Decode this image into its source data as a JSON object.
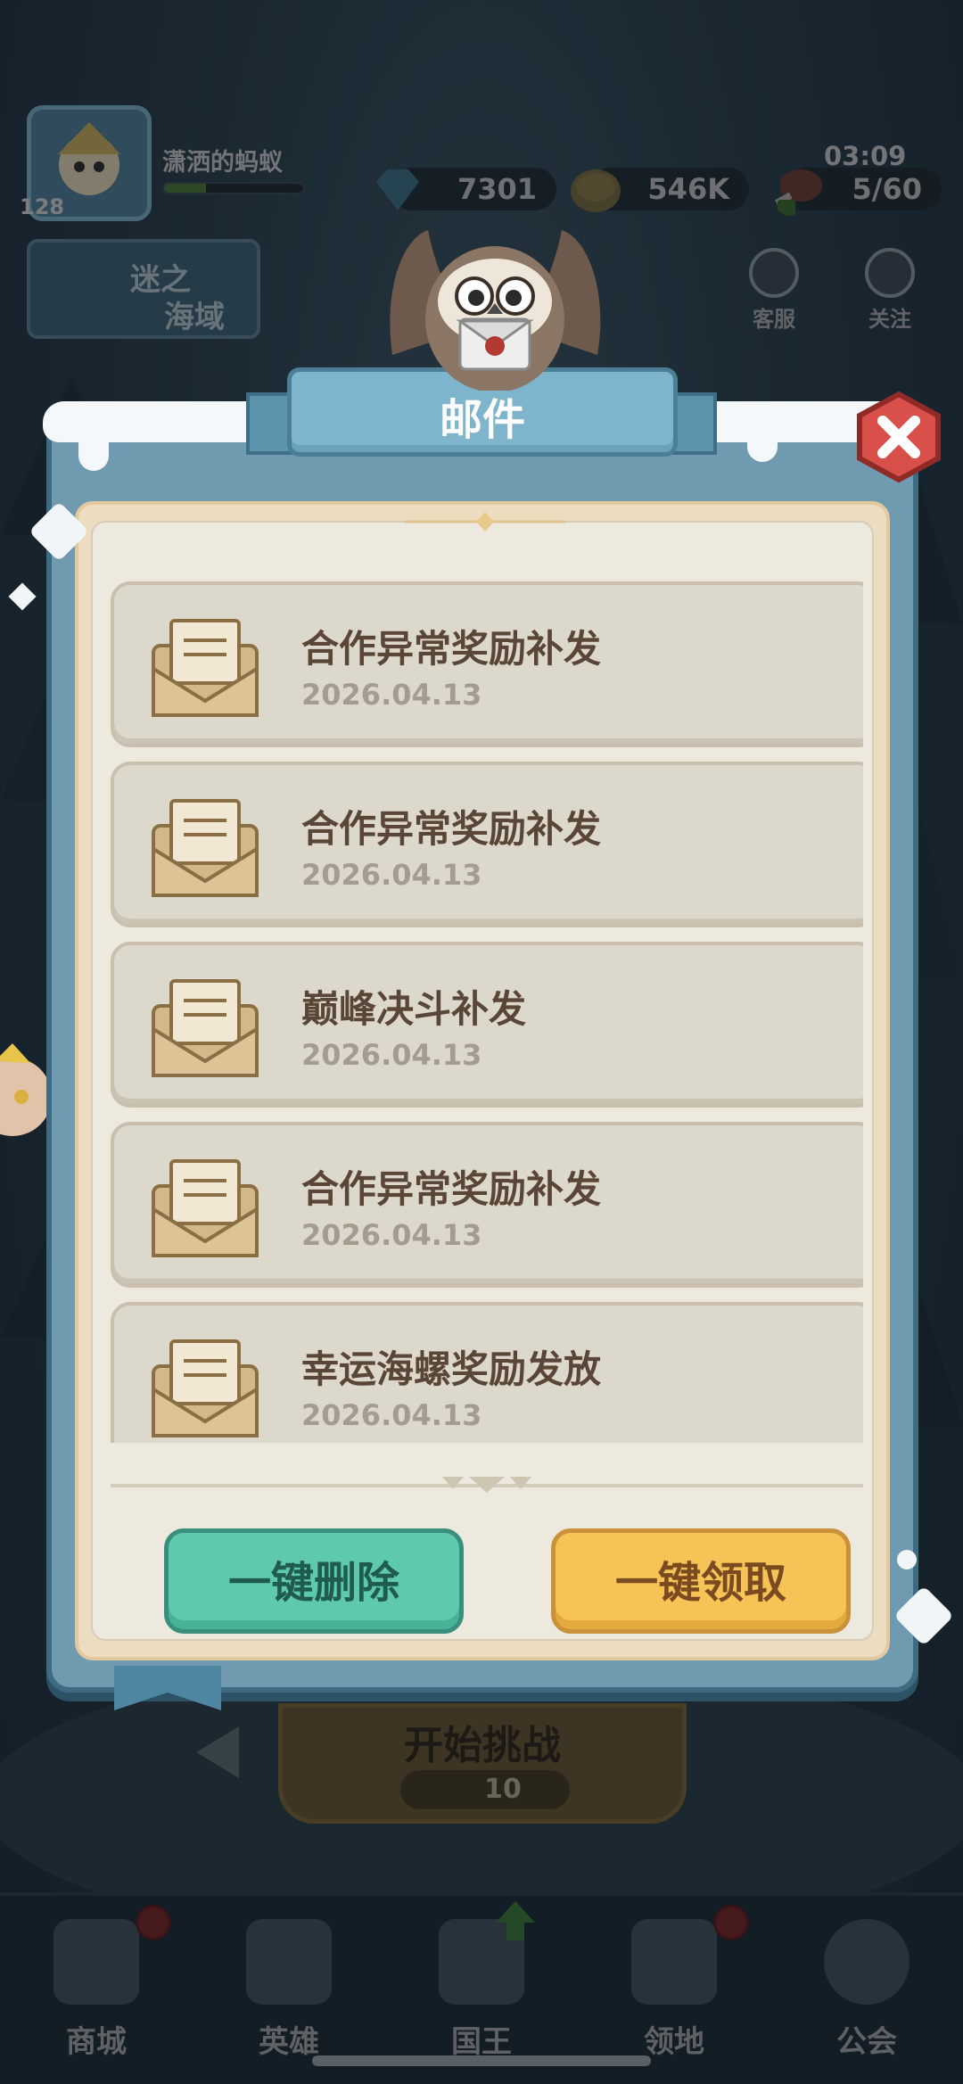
{
  "hud": {
    "player_name": "潇洒的蚂蚁",
    "level": "128",
    "exp_fill_fraction": 0.3,
    "gems": "7301",
    "gold": "546K",
    "stamina": "5/60",
    "time": "03:09",
    "support_label": "客服",
    "follow_label": "关注",
    "banner_line1": "迷之",
    "banner_line2": "海域"
  },
  "mail_dialog": {
    "title": "邮件",
    "items": [
      {
        "title": "合作异常奖励补发",
        "date": "2026.04.13"
      },
      {
        "title": "合作异常奖励补发",
        "date": "2026.04.13"
      },
      {
        "title": "巅峰决斗补发",
        "date": "2026.04.13"
      },
      {
        "title": "合作异常奖励补发",
        "date": "2026.04.13"
      },
      {
        "title": "幸运海螺奖励发放",
        "date": "2026.04.13"
      }
    ],
    "delete_all_label": "一键删除",
    "claim_all_label": "一键领取"
  },
  "challenge": {
    "title": "开始挑战",
    "cost": "10"
  },
  "bottom_nav": [
    {
      "label": "商城",
      "badge": true
    },
    {
      "label": "英雄",
      "badge": false
    },
    {
      "label": "国王",
      "badge": false
    },
    {
      "label": "领地",
      "badge": true
    },
    {
      "label": "公会",
      "badge": false
    }
  ],
  "colors": {
    "delete_button": "#5ec9ad",
    "claim_button": "#f5c356",
    "close_button": "#d9504a",
    "panel_frame": "#6f9ab0"
  }
}
